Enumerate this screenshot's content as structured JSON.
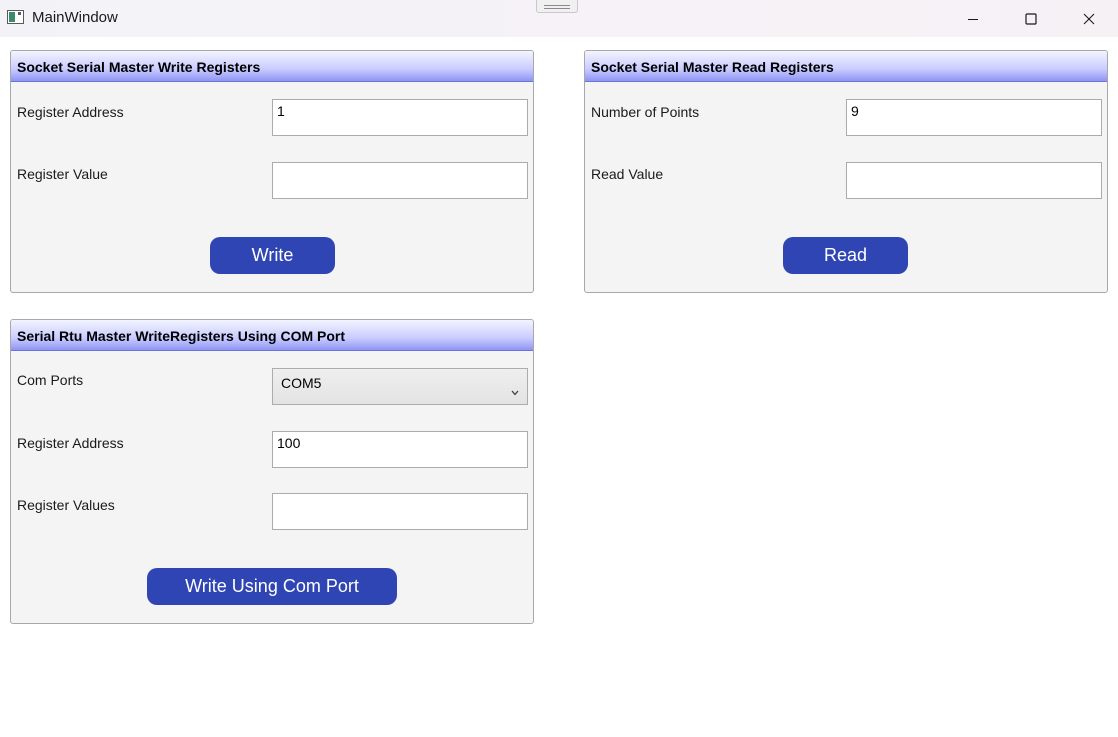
{
  "window": {
    "title": "MainWindow"
  },
  "write_panel": {
    "title": "Socket Serial Master Write Registers",
    "register_address_label": "Register Address",
    "register_address_value": "1",
    "register_value_label": "Register Value",
    "register_value_value": "",
    "button_label": "Write"
  },
  "read_panel": {
    "title": "Socket Serial Master Read Registers",
    "number_of_points_label": "Number of Points",
    "number_of_points_value": "9",
    "read_value_label": "Read Value",
    "read_value_value": "",
    "button_label": "Read"
  },
  "com_panel": {
    "title": "Serial Rtu Master WriteRegisters Using COM Port",
    "com_ports_label": "Com Ports",
    "com_ports_selected": "COM5",
    "register_address_label": "Register Address",
    "register_address_value": "100",
    "register_values_label": "Register Values",
    "register_values_value": "",
    "button_label": "Write Using Com Port"
  },
  "colors": {
    "button_background": "#2f45b3",
    "header_gradient_end": "#8f95f5"
  },
  "icons": {
    "app": "window-app-icon",
    "minimize": "minimize-icon",
    "maximize": "maximize-icon",
    "close": "close-icon",
    "combo": "chevron-down-icon"
  }
}
